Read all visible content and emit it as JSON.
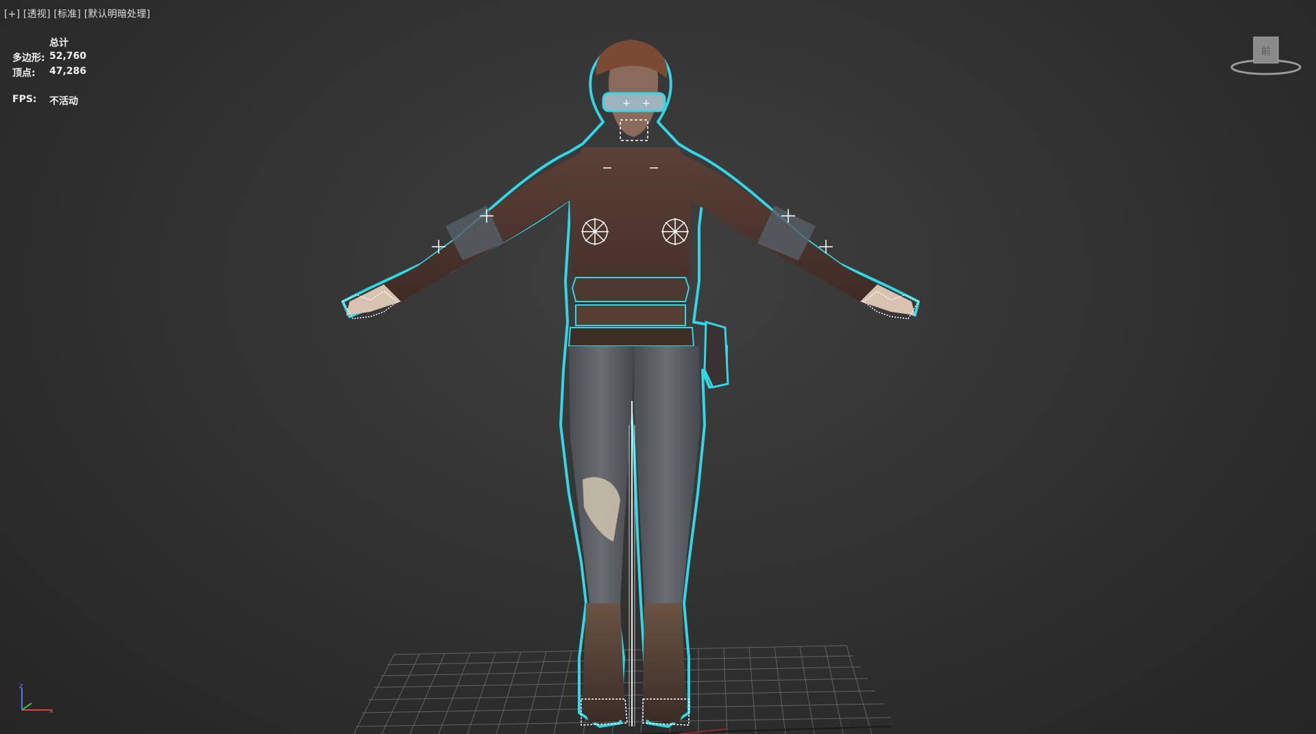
{
  "viewport": {
    "menu_plus": "[+]",
    "menu_view": "[透视]",
    "menu_shading_standard": "[标准]",
    "menu_lighting": "[默认明暗处理]",
    "label_separator": " "
  },
  "stats": {
    "header": "总计",
    "polygons_label": "多边形:",
    "polygons_value": "52,760",
    "vertices_label": "顶点:",
    "vertices_value": "47,286",
    "fps_label": "FPS:",
    "fps_value": "不活动"
  },
  "viewcube": {
    "face_label": "前"
  },
  "axis_tripod": {
    "z_label": "z",
    "x_label": "x"
  },
  "colors": {
    "selection_outline": "#2fd8e4",
    "background": "#363636",
    "grid": "#6e6e6e",
    "helper": "#ffffff"
  }
}
